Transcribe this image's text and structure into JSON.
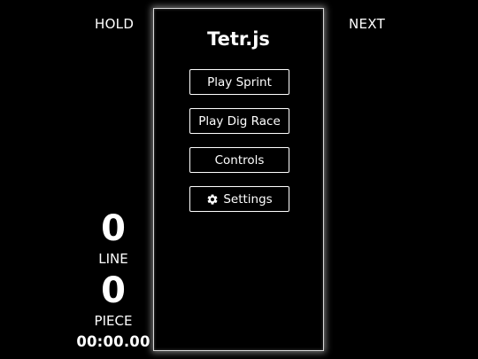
{
  "side": {
    "hold_label": "HOLD",
    "next_label": "NEXT"
  },
  "board": {
    "title": "Tetr.js"
  },
  "menu": {
    "play_sprint": "Play Sprint",
    "play_dig_race": "Play Dig Race",
    "controls": "Controls",
    "settings": "Settings",
    "settings_icon": "gear-icon"
  },
  "stats": {
    "lines_value": "0",
    "lines_label": "LINE",
    "pieces_value": "0",
    "pieces_label": "PIECE",
    "timer": "00:00.00"
  },
  "colors": {
    "background": "#000000",
    "foreground": "#ffffff",
    "board_border": "#d8d8d8"
  }
}
